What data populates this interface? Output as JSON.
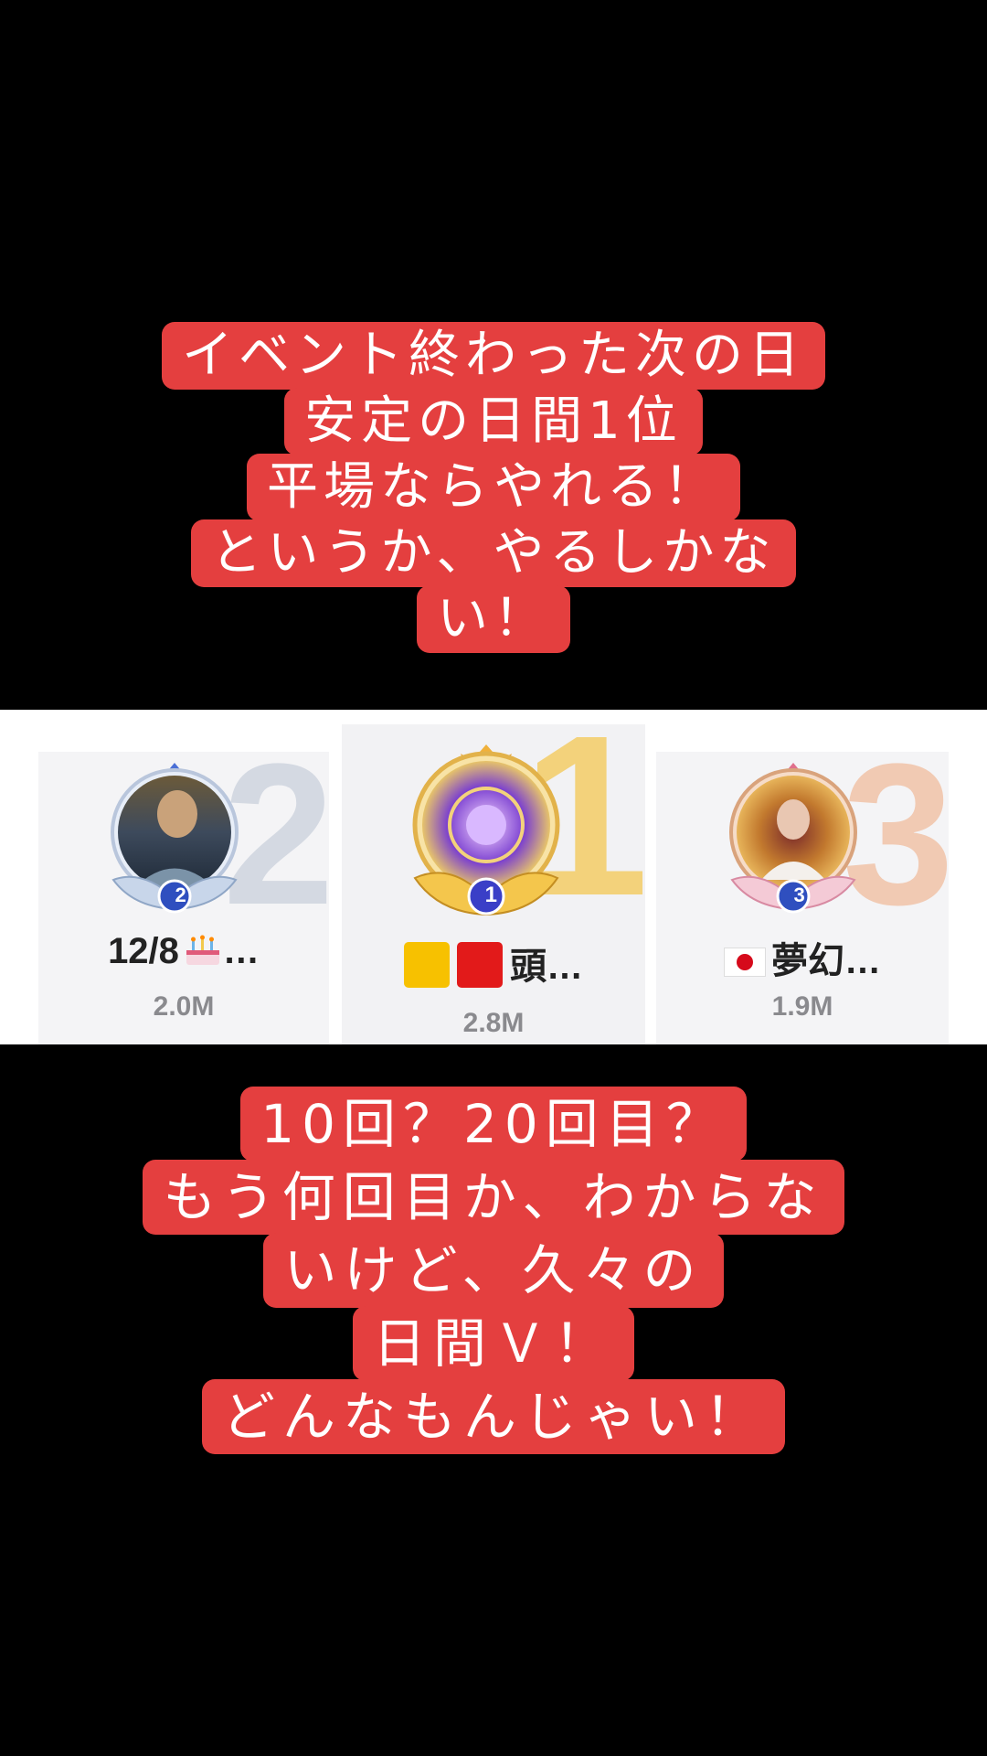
{
  "caption_top": [
    "イベント終わった次の日",
    "安定の日間1位",
    "平場ならやれる！",
    "というか、やるしかな",
    "い！"
  ],
  "caption_bottom": [
    "10回？20回目？",
    "もう何回目か、わからな",
    "いけど、久々の",
    "日間Ｖ！",
    "どんなもんじゃい！"
  ],
  "leaderboard": {
    "rank1": {
      "rank": "1",
      "name": "頭…",
      "score": "2.8M",
      "badge": "1",
      "emoji": "yellow-square red-square"
    },
    "rank2": {
      "rank": "2",
      "name": "12/8",
      "name_suffix": "…",
      "score": "2.0M",
      "badge": "2",
      "emoji": "birthday-cake"
    },
    "rank3": {
      "rank": "3",
      "name": "夢幻…",
      "score": "1.9M",
      "badge": "3",
      "emoji": "japan-flag"
    }
  },
  "colors": {
    "caption_bg": "#e43f3f",
    "caption_text": "#ffffff",
    "gold": "#f3d27b",
    "silver": "#d4d9e2",
    "bronze": "#f1cab3"
  }
}
